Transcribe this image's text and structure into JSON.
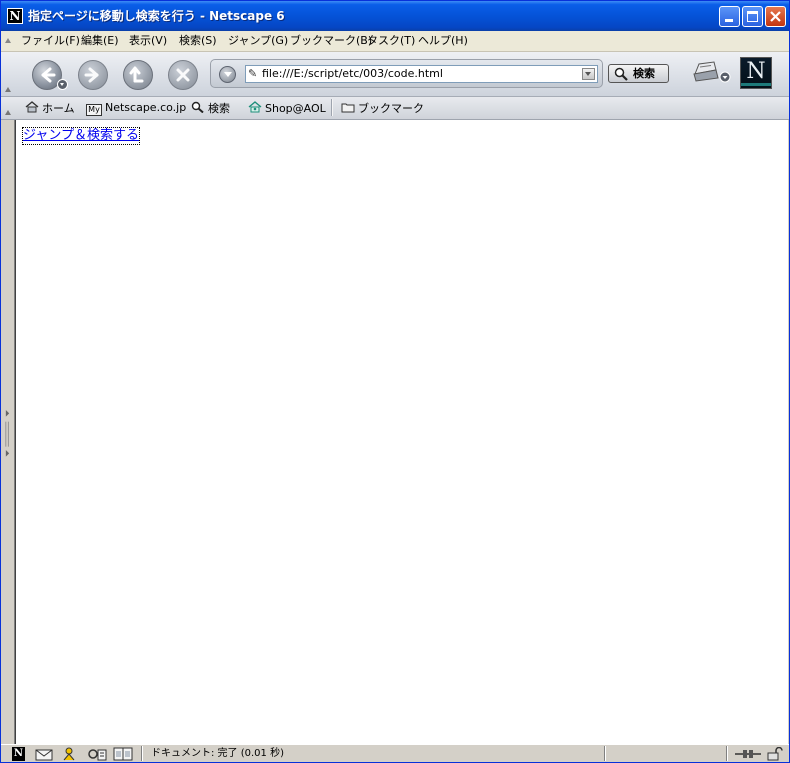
{
  "window": {
    "title": "指定ページに移動し検索を行う - Netscape 6",
    "app_icon_letter": "N"
  },
  "menu": {
    "items": [
      "ファイル(F)",
      "編集(E)",
      "表示(V)",
      "検索(S)",
      "ジャンプ(G)",
      "ブックマーク(B)",
      "タスク(T)",
      "ヘルプ(H)"
    ]
  },
  "toolbar": {
    "back_icon": "back-arrow-icon",
    "forward_icon": "forward-arrow-icon",
    "reload_icon": "reload-icon",
    "stop_icon": "stop-icon",
    "url": "file:///E:/script/etc/003/code.html",
    "search_label": "検索",
    "logo_letter": "N"
  },
  "bookmarks": {
    "home": "ホーム",
    "netscape": "Netscape.co.jp",
    "netscape_badge": "My",
    "search": "検索",
    "shop": "Shop@AOL",
    "bookmarks": "ブックマーク"
  },
  "content": {
    "link_text": "ジャンプ＆検索する"
  },
  "status": {
    "text": "ドキュメント: 完了 (0.01 秒)",
    "netscape_letter": "N"
  },
  "colors": {
    "titlebar": "#0553d8",
    "link": "#0000ee",
    "chrome": "#d4d0c8"
  }
}
